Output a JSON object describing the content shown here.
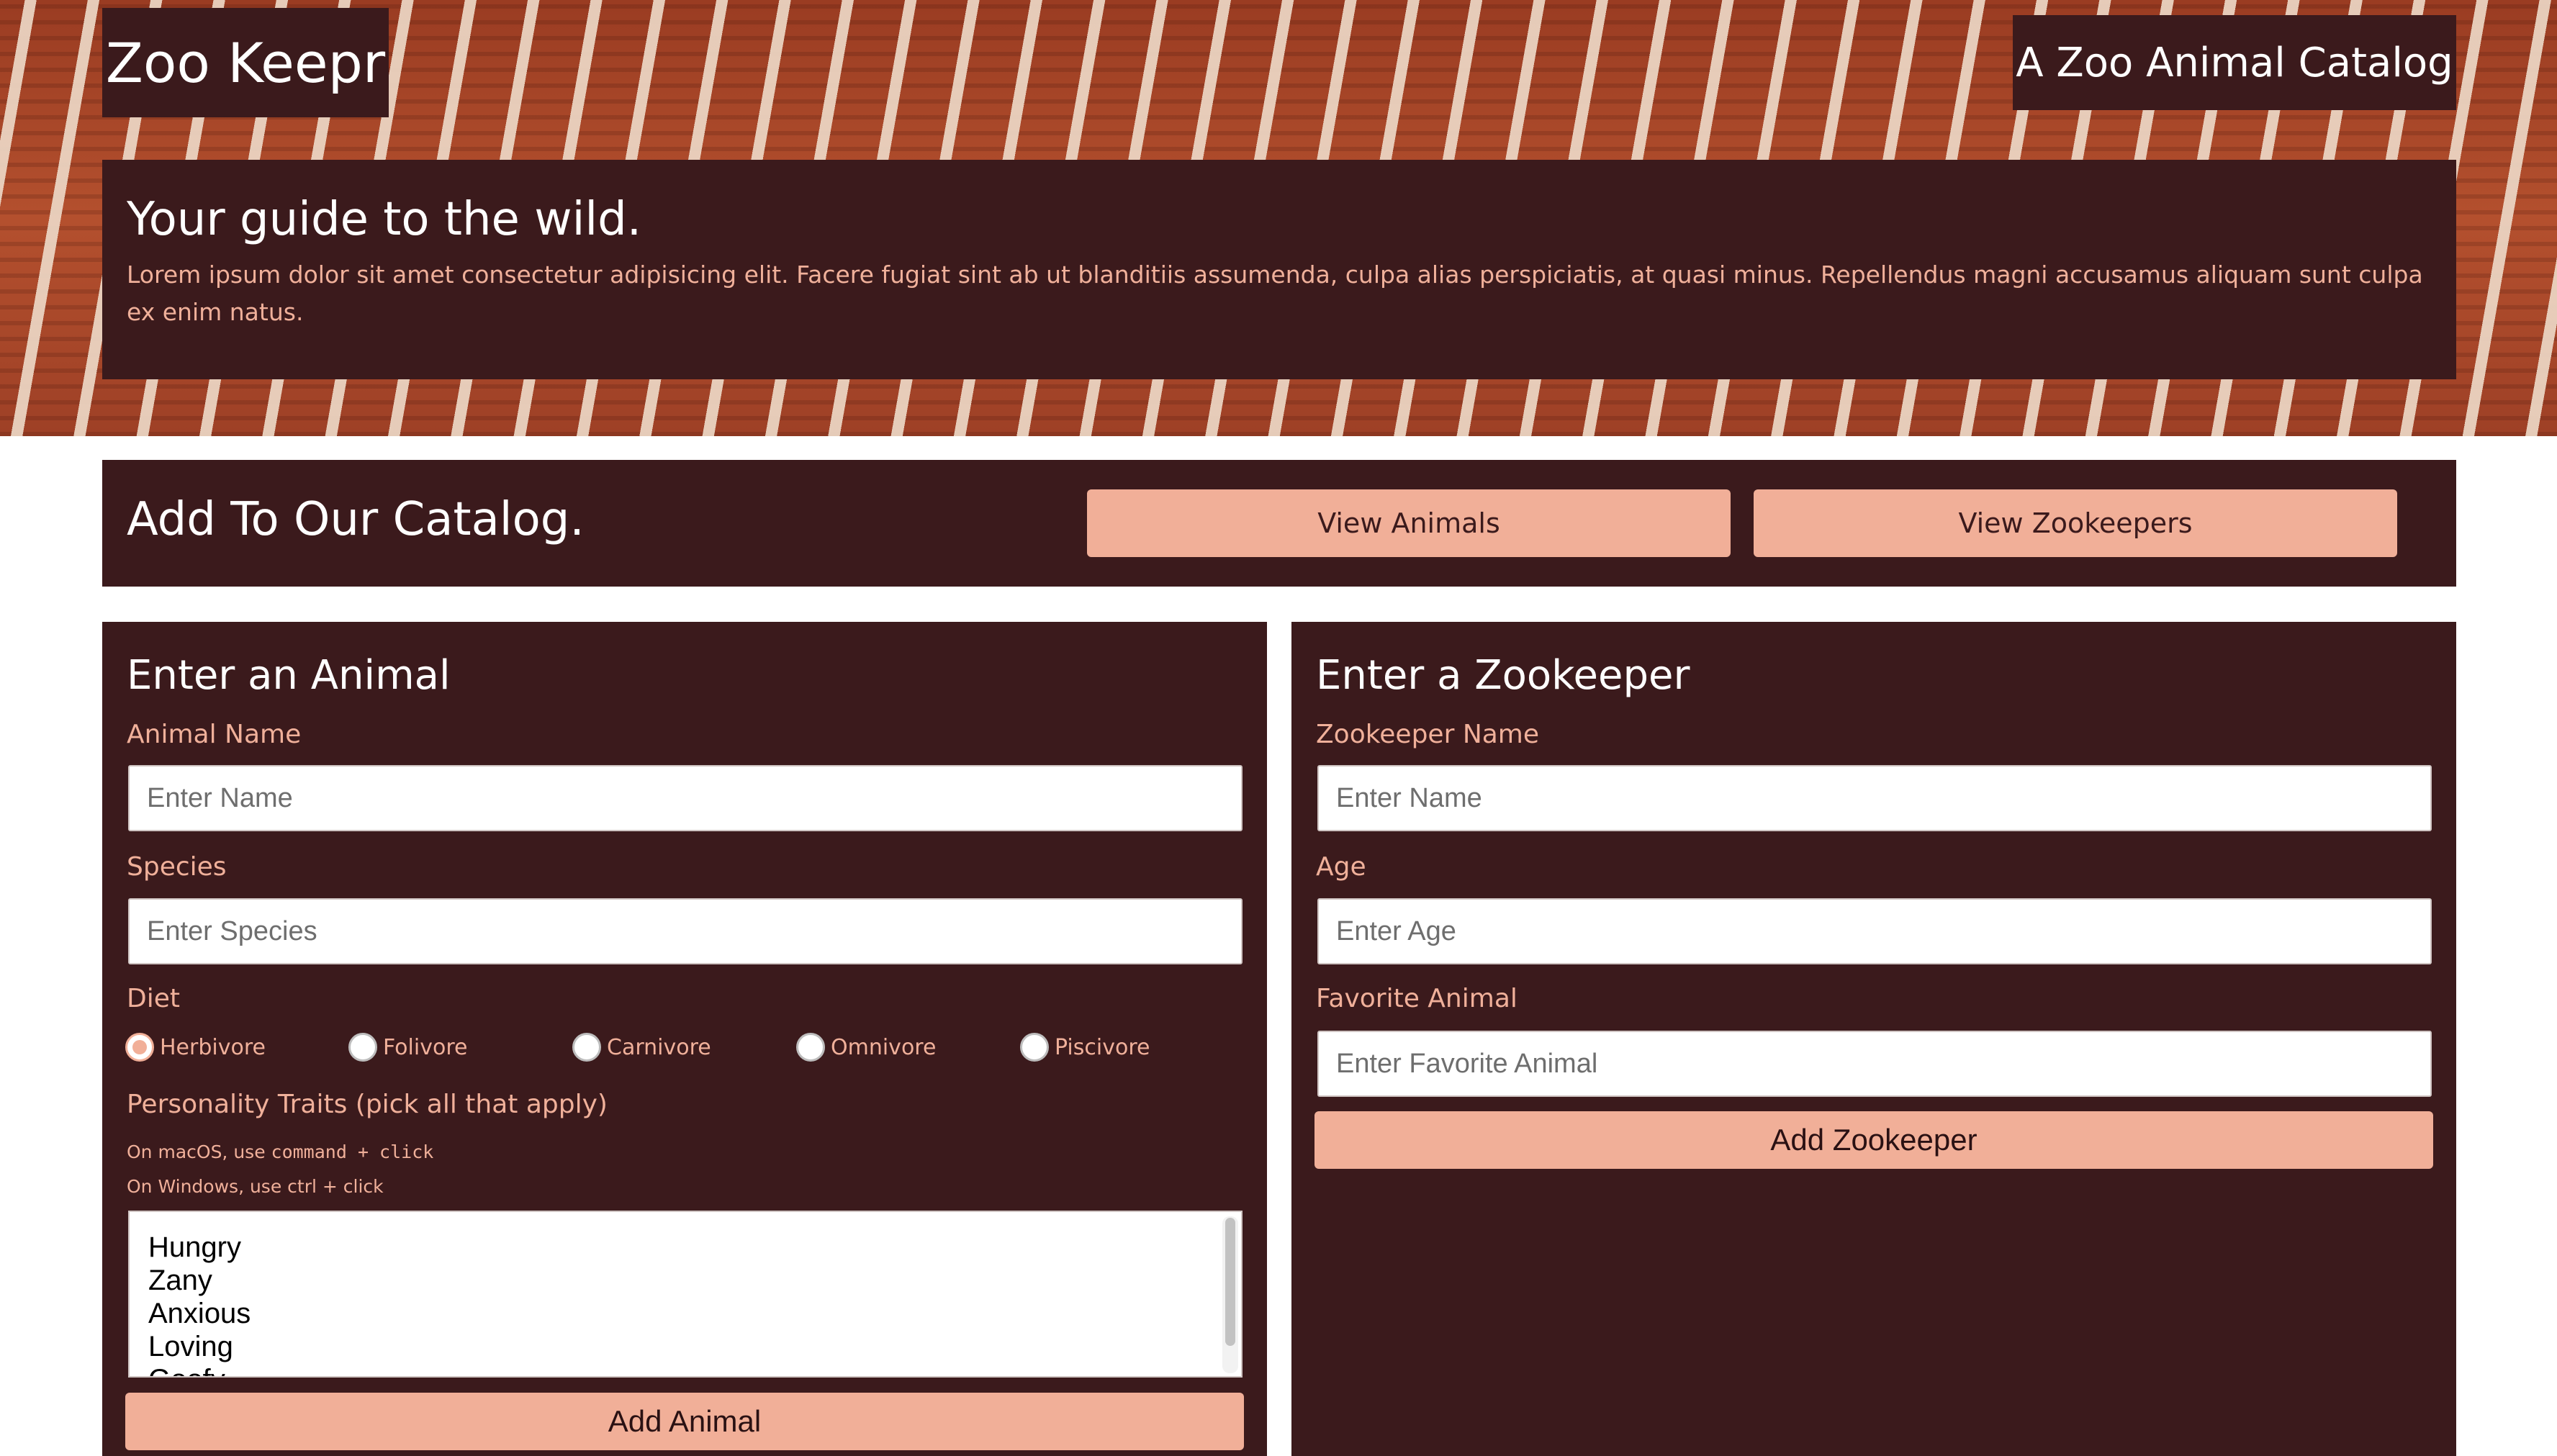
{
  "header": {
    "brand": "Zoo Keepr",
    "subtitle": "A Zoo Animal Catalog"
  },
  "intro": {
    "heading": "Your guide to the wild.",
    "body": "Lorem ipsum dolor sit amet consectetur adipisicing elit. Facere fugiat sint ab ut blanditiis assumenda, culpa alias perspiciatis, at quasi minus. Repellendus magni accusamus aliquam sunt culpa ex enim natus."
  },
  "catalog": {
    "heading": "Add To Our Catalog.",
    "view_animals": "View Animals",
    "view_zookeepers": "View Zookeepers"
  },
  "animal_form": {
    "heading": "Enter an Animal",
    "name_label": "Animal Name",
    "name_placeholder": "Enter Name",
    "species_label": "Species",
    "species_placeholder": "Enter Species",
    "diet_label": "Diet",
    "diet_options": [
      "Herbivore",
      "Folivore",
      "Carnivore",
      "Omnivore",
      "Piscivore"
    ],
    "diet_selected": "Herbivore",
    "traits_label": "Personality Traits (pick all that apply)",
    "hint_mac_prefix": "On macOS, use",
    "hint_mac_code": "command + click",
    "hint_windows": "On Windows, use ctrl + click",
    "traits": [
      "Hungry",
      "Zany",
      "Anxious",
      "Loving",
      "Goofy"
    ],
    "submit": "Add Animal"
  },
  "keeper_form": {
    "heading": "Enter a Zookeeper",
    "name_label": "Zookeeper Name",
    "name_placeholder": "Enter Name",
    "age_label": "Age",
    "age_placeholder": "Enter Age",
    "favorite_label": "Favorite Animal",
    "favorite_placeholder": "Enter Favorite Animal",
    "submit": "Add Zookeeper"
  },
  "colors": {
    "panel_bg": "#3b1a1c",
    "accent": "#f1af98",
    "label_text": "#f0b09a"
  }
}
